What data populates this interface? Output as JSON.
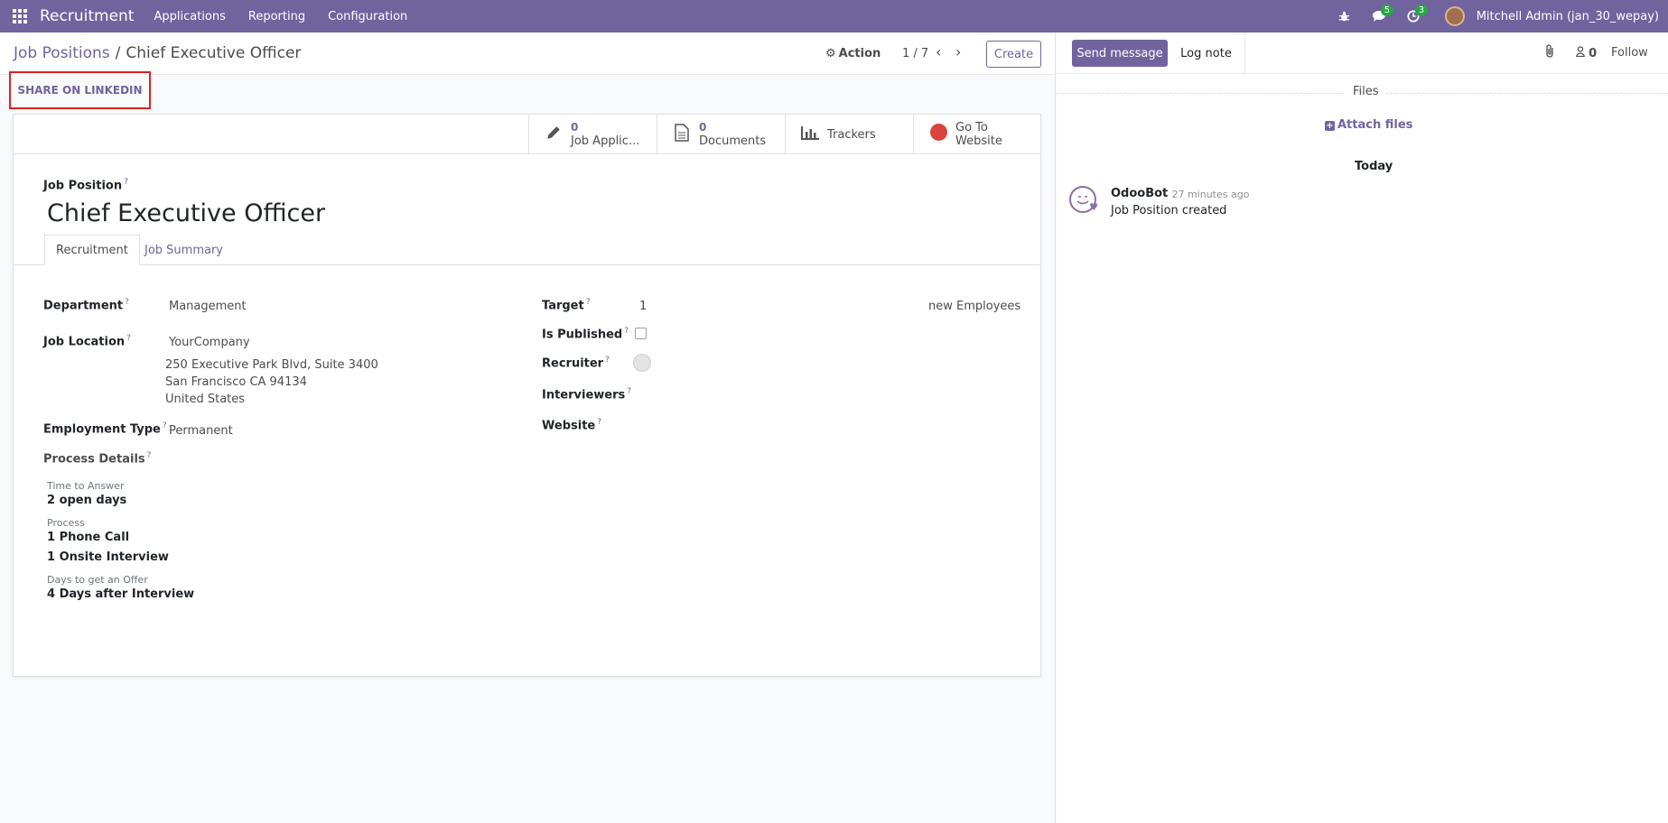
{
  "navbar": {
    "brand": "Recruitment",
    "menu": [
      "Applications",
      "Reporting",
      "Configuration"
    ],
    "messages_count": "5",
    "activities_count": "3",
    "user": "Mitchell Admin (jan_30_wepay)",
    "icons": [
      "apps-icon",
      "bug-icon",
      "chat-icon",
      "clock-icon"
    ]
  },
  "control_panel": {
    "breadcrumb_parent": "Job Positions",
    "breadcrumb_sep": "/",
    "breadcrumb_current": "Chief Executive Officer",
    "action": "Action",
    "pager": "1 / 7",
    "create": "Create",
    "share_linkedin": "SHARE ON LINKEDIN"
  },
  "smart_buttons": [
    {
      "count": "0",
      "label": "Job Applic...",
      "icon": "pencil-icon"
    },
    {
      "count": "0",
      "label": "Documents",
      "icon": "document-icon"
    },
    {
      "count": "",
      "label": "Trackers",
      "icon": "bar-chart-icon"
    },
    {
      "count": "",
      "label_line1": "Go To",
      "label_line2": "Website",
      "icon": "globe-icon"
    }
  ],
  "form": {
    "job_position_label": "Job Position",
    "job_position_value": "Chief Executive Officer",
    "tabs": [
      "Recruitment",
      "Job Summary"
    ],
    "department_label": "Department",
    "department_value": "Management",
    "job_location_label": "Job Location",
    "job_location_company": "YourCompany",
    "job_location_address1": "250 Executive Park Blvd, Suite 3400",
    "job_location_address2": "San Francisco CA 94134",
    "job_location_address3": "United States",
    "employment_type_label": "Employment Type",
    "employment_type_value": "Permanent",
    "process_details_label": "Process Details",
    "time_to_answer_label": "Time to Answer",
    "time_to_answer_value": "2 open days",
    "process_label": "Process",
    "process_value1": "1 Phone Call",
    "process_value2": "1 Onsite Interview",
    "days_offer_label": "Days to get an Offer",
    "days_offer_value": "4 Days after Interview",
    "target_label": "Target",
    "target_value": "1",
    "target_suffix": "new Employees",
    "is_published_label": "Is Published",
    "is_published": false,
    "recruiter_label": "Recruiter",
    "interviewers_label": "Interviewers",
    "website_label": "Website",
    "help_mark": "?"
  },
  "chatter": {
    "send_message": "Send message",
    "log_note": "Log note",
    "followers_count": "0",
    "follow": "Follow",
    "files_title": "Files",
    "attach_files": "Attach files",
    "today": "Today",
    "message": {
      "author": "OdooBot",
      "time": "- 27 minutes ago",
      "body": "Job Position created"
    }
  },
  "colors": {
    "brand": "#71639e",
    "highlight_border": "#e02020",
    "badge": "#28a745"
  }
}
